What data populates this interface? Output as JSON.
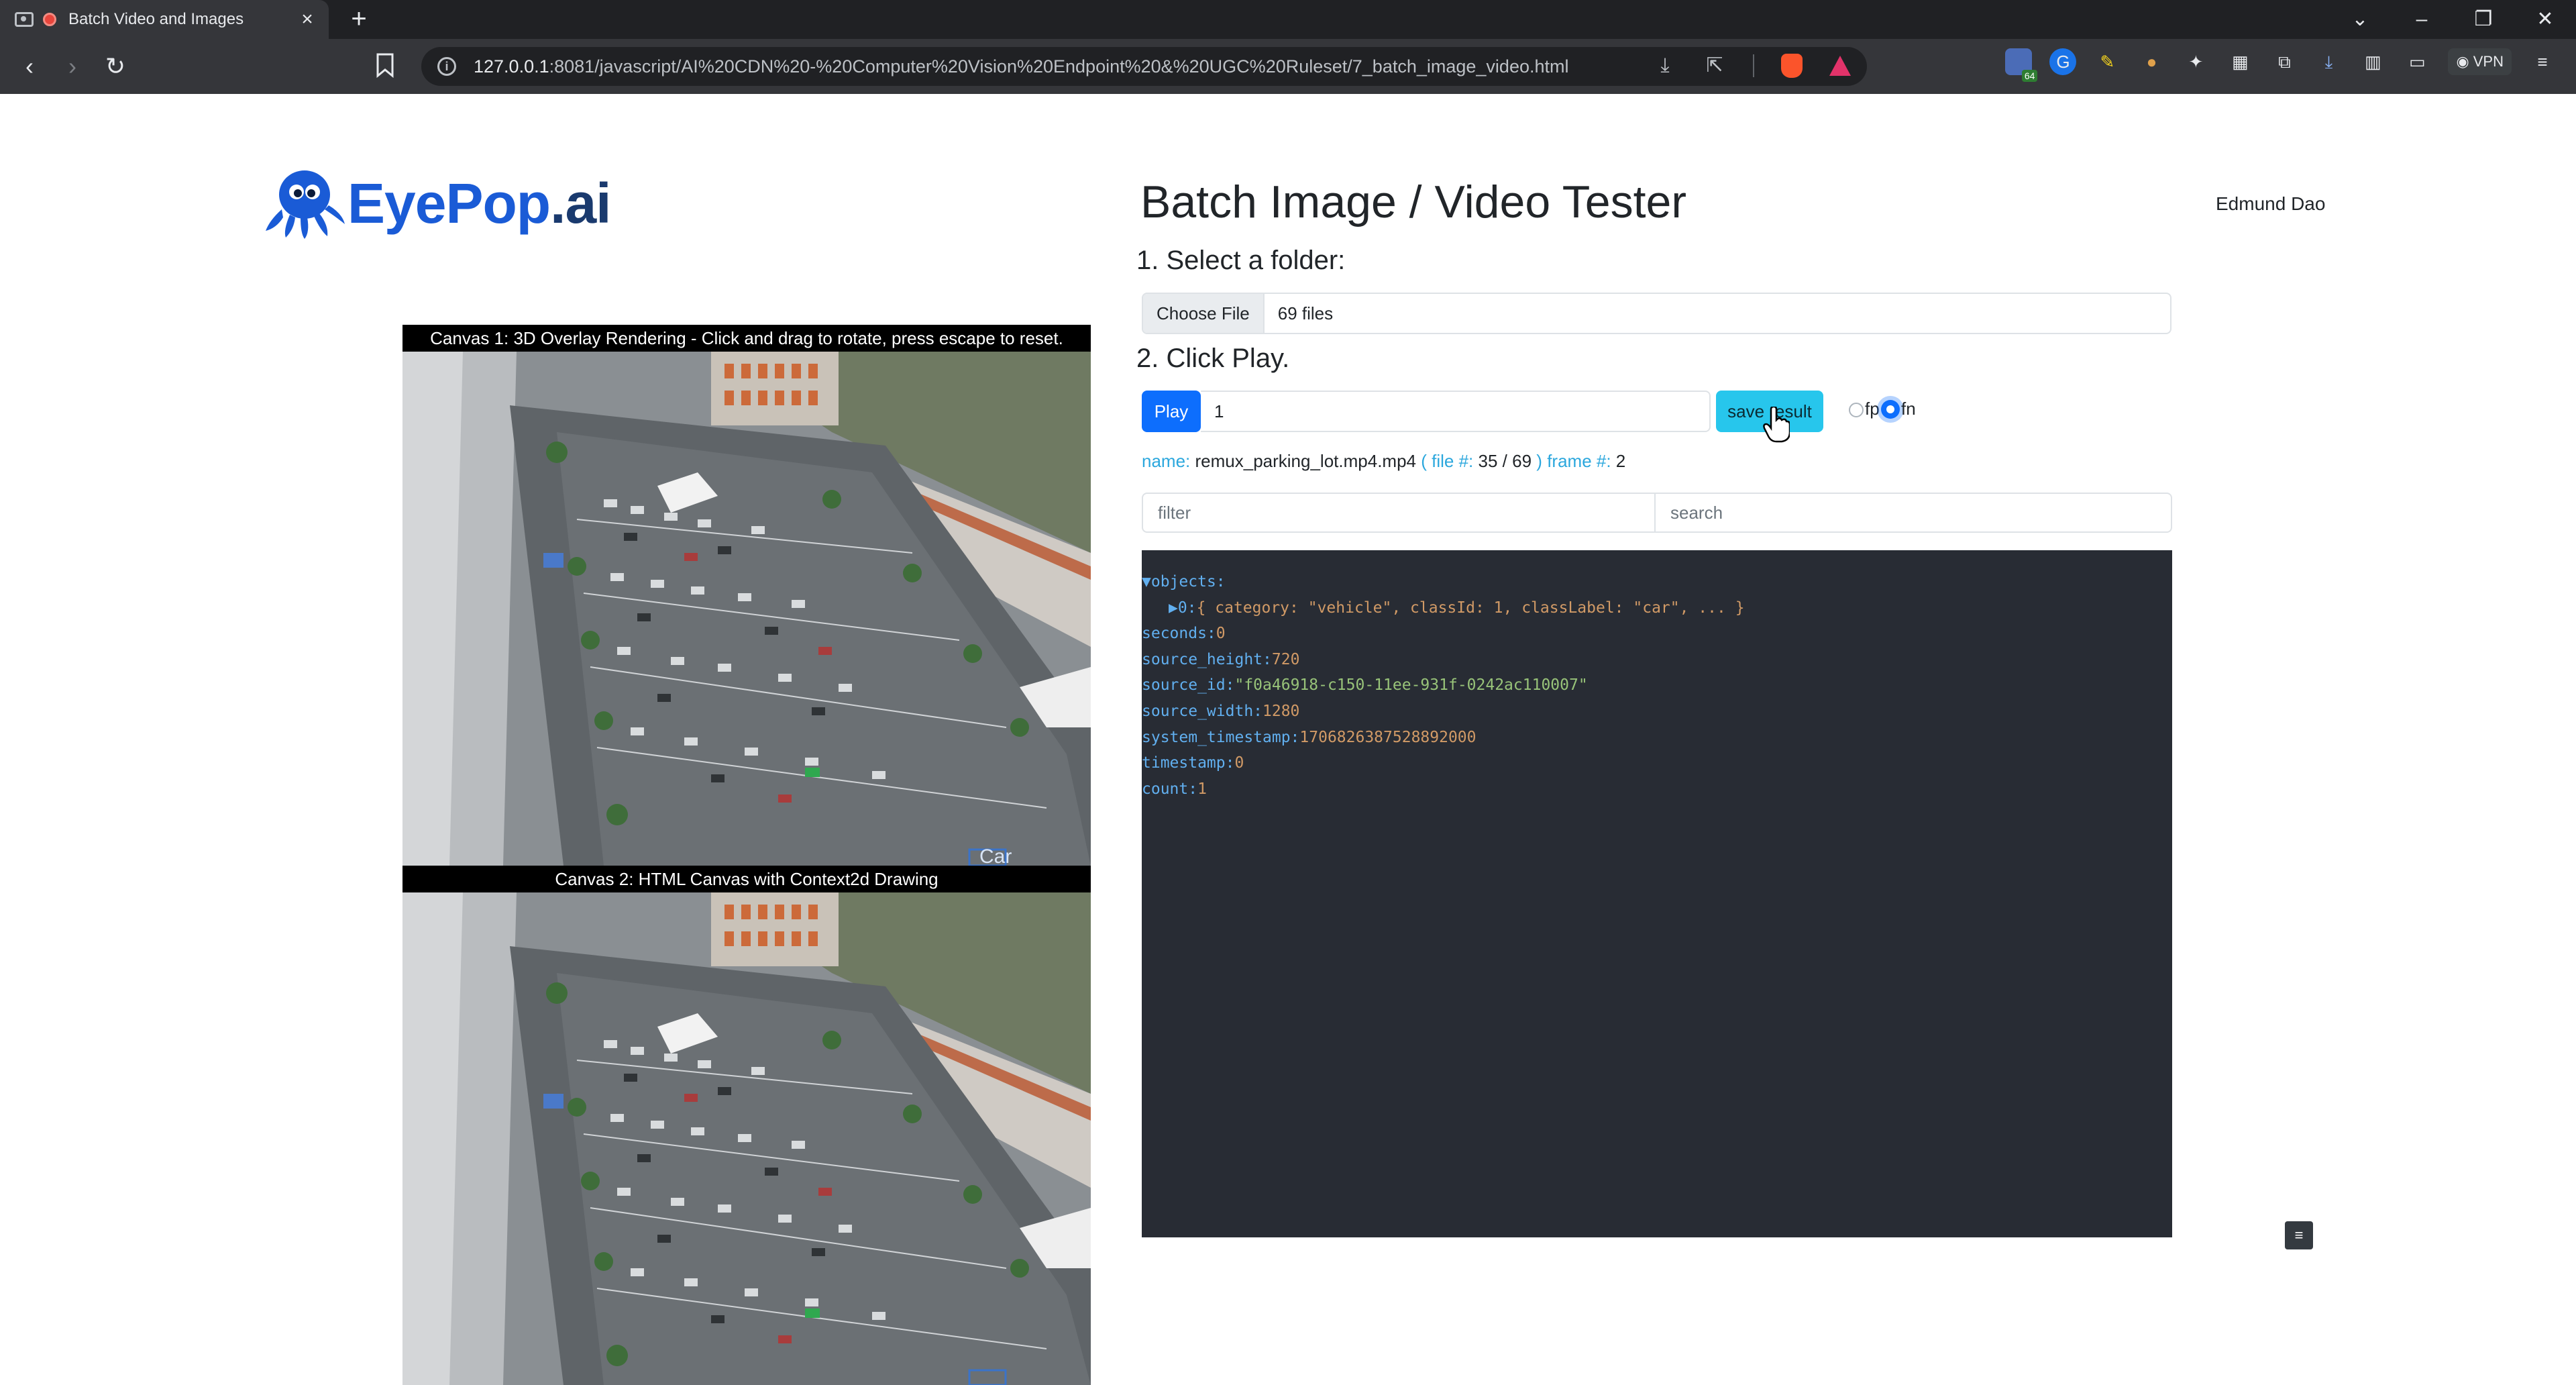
{
  "browser": {
    "tab_title": "Batch Video and Images",
    "url_host": "127.0.0.1",
    "url_rest": ":8081/javascript/AI%20CDN%20-%20Computer%20Vision%20Endpoint%20&%20UGC%20Ruleset/7_batch_image_video.html",
    "extension_badge": "64",
    "vpn_label": "VPN"
  },
  "logo": {
    "brand_eye": "EyePop",
    "brand_ai": ".ai"
  },
  "header": {
    "title": "Batch Image / Video Tester",
    "user": "Edmund Dao"
  },
  "steps": {
    "step1": "1. Select a folder:",
    "step2": "2. Click Play."
  },
  "file_input": {
    "button_label": "Choose File",
    "status": "69 files"
  },
  "controls": {
    "play_label": "Play",
    "frame_value": "1",
    "save_label": "save result",
    "radio_fp_label": "fp",
    "radio_fn_label": "fn",
    "selected_radio": "fn"
  },
  "meta": {
    "name_label": "name:",
    "name_value": "remux_parking_lot.mp4.mp4",
    "file_label_open": "( file #:",
    "file_index": "35",
    "file_sep": "/",
    "file_total": "69",
    "file_label_close": ")",
    "frame_label": "frame #:",
    "frame_value": "2"
  },
  "search": {
    "filter_placeholder": "filter",
    "search_placeholder": "search"
  },
  "json_view": {
    "objects_key": "objects:",
    "object0_index": "0:",
    "object0_summary": "{ category: \"vehicle\", classId: 1, classLabel: \"car\", ... }",
    "seconds_key": "seconds:",
    "seconds_val": "0",
    "source_height_key": "source_height:",
    "source_height_val": "720",
    "source_id_key": "source_id:",
    "source_id_val": "\"f0a46918-c150-11ee-931f-0242ac110007\"",
    "source_width_key": "source_width:",
    "source_width_val": "1280",
    "system_timestamp_key": "system_timestamp:",
    "system_timestamp_val": "1706826387528892000",
    "timestamp_key": "timestamp:",
    "timestamp_val": "0",
    "count_key": "count:",
    "count_val": "1"
  },
  "canvas1": {
    "label": "Canvas 1: 3D Overlay Rendering - Click and drag to rotate, press escape to reset.",
    "detection_label": "Car"
  },
  "canvas2": {
    "label": "Canvas 2: HTML Canvas with Context2d Drawing"
  },
  "colors": {
    "primary": "#0d6efd",
    "info": "#27c6ec",
    "json_bg": "#282c34",
    "link_blue": "#2ba7dd"
  }
}
